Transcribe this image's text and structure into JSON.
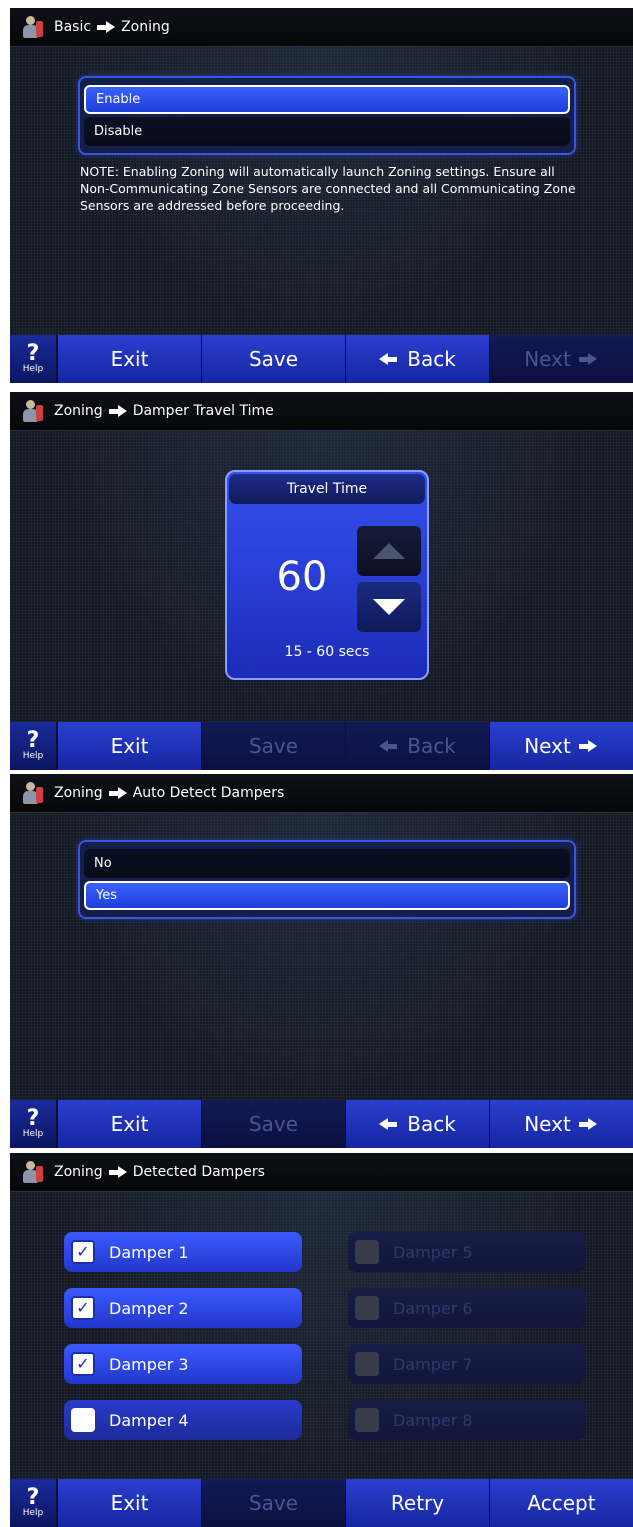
{
  "screens": [
    {
      "breadcrumb": {
        "from": "Basic",
        "to": "Zoning"
      },
      "options": [
        "Enable",
        "Disable"
      ],
      "selected": "Enable",
      "note": "NOTE: Enabling Zoning will automatically launch Zoning settings. Ensure all Non-Communicating Zone Sensors are connected and all Communicating Zone Sensors are addressed before proceeding.",
      "footer": {
        "help_q": "?",
        "help": "Help",
        "exit": "Exit",
        "save": "Save",
        "back": "Back",
        "next": "Next"
      }
    },
    {
      "breadcrumb": {
        "from": "Zoning",
        "to": "Damper Travel Time"
      },
      "travel_time": {
        "title": "Travel Time",
        "value": "60",
        "range": "15 - 60 secs"
      },
      "footer": {
        "help_q": "?",
        "help": "Help",
        "exit": "Exit",
        "save": "Save",
        "back": "Back",
        "next": "Next"
      }
    },
    {
      "breadcrumb": {
        "from": "Zoning",
        "to": "Auto Detect Dampers"
      },
      "options": [
        "No",
        "Yes"
      ],
      "selected": "Yes",
      "footer": {
        "help_q": "?",
        "help": "Help",
        "exit": "Exit",
        "save": "Save",
        "back": "Back",
        "next": "Next"
      }
    },
    {
      "breadcrumb": {
        "from": "Zoning",
        "to": "Detected Dampers"
      },
      "dampers": [
        {
          "label": "Damper 1",
          "checked": true,
          "enabled": true
        },
        {
          "label": "Damper 2",
          "checked": true,
          "enabled": true
        },
        {
          "label": "Damper 3",
          "checked": true,
          "enabled": true
        },
        {
          "label": "Damper 4",
          "checked": false,
          "enabled": true
        },
        {
          "label": "Damper 5",
          "checked": false,
          "enabled": false
        },
        {
          "label": "Damper 6",
          "checked": false,
          "enabled": false
        },
        {
          "label": "Damper 7",
          "checked": false,
          "enabled": false
        },
        {
          "label": "Damper 8",
          "checked": false,
          "enabled": false
        }
      ],
      "footer": {
        "help_q": "?",
        "help": "Help",
        "exit": "Exit",
        "save": "Save",
        "retry": "Retry",
        "accept": "Accept"
      }
    }
  ],
  "colors": {
    "accent": "#2b3fd0",
    "disabled": "#4b5590",
    "background": "#141a24"
  }
}
